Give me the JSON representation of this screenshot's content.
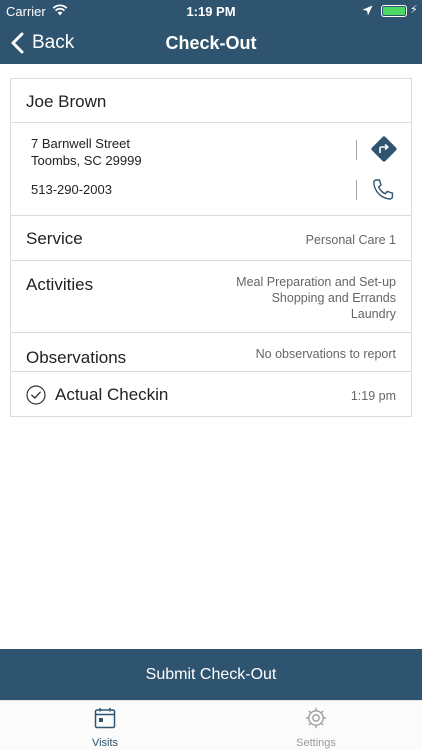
{
  "status_bar": {
    "carrier": "Carrier",
    "time": "1:19 PM",
    "battery_color": "#4cd964"
  },
  "nav": {
    "back_label": "Back",
    "title": "Check-Out"
  },
  "client": {
    "name": "Joe Brown",
    "address_line1": "7 Barnwell Street",
    "address_line2": "Toombs, SC 29999",
    "phone": "513-290-2003"
  },
  "details": {
    "service_label": "Service",
    "service_value": "Personal Care 1",
    "activities_label": "Activities",
    "activities": [
      "Meal Preparation and Set-up",
      "Shopping and Errands",
      "Laundry"
    ],
    "observations_label": "Observations",
    "observations_value": "No observations to report",
    "checkin_label": "Actual Checkin",
    "checkin_value": "1:19 pm"
  },
  "submit_label": "Submit Check-Out",
  "tabs": {
    "visits_label": "Visits",
    "settings_label": "Settings"
  },
  "colors": {
    "brand": "#2f5470",
    "tab_active": "#2f5470",
    "tab_inactive": "#9b9b9b"
  }
}
